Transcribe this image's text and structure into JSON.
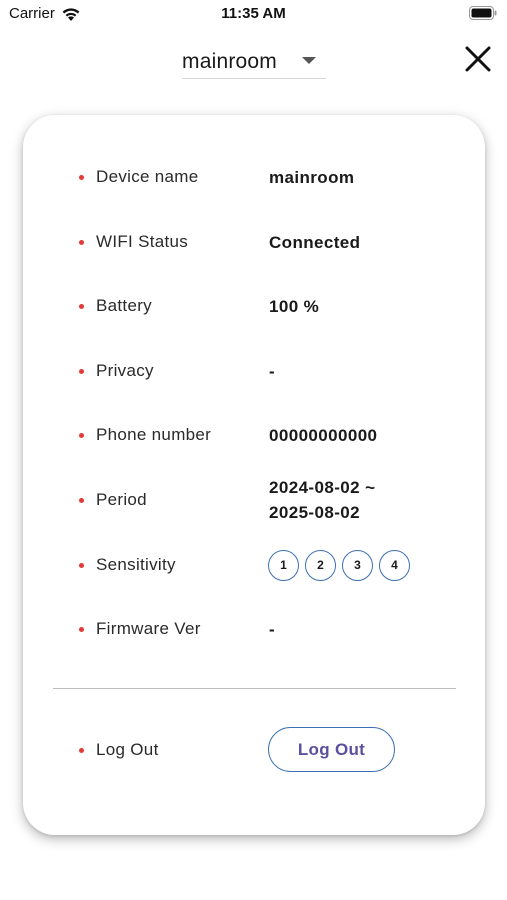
{
  "status_bar": {
    "carrier": "Carrier",
    "time": "11:35 AM"
  },
  "header": {
    "device_select_value": "mainroom"
  },
  "info": {
    "device_name_label": "Device name",
    "device_name_value": "mainroom",
    "wifi_label": "WIFI Status",
    "wifi_value": "Connected",
    "battery_label": "Battery",
    "battery_value": "100 %",
    "privacy_label": "Privacy",
    "privacy_value": "-",
    "phone_label": "Phone number",
    "phone_value": "00000000000",
    "period_label": "Period",
    "period_start": "2024-08-02 ~",
    "period_end": "2025-08-02",
    "sensitivity_label": "Sensitivity",
    "sensitivity_levels": [
      "1",
      "2",
      "3",
      "4"
    ],
    "firmware_label": "Firmware Ver",
    "firmware_value": "-"
  },
  "logout": {
    "label": "Log Out",
    "button_label": "Log Out"
  },
  "colors": {
    "bullet": "#e53935",
    "accent_border": "#3d6fb5",
    "logout_text": "#5b4fa0"
  }
}
